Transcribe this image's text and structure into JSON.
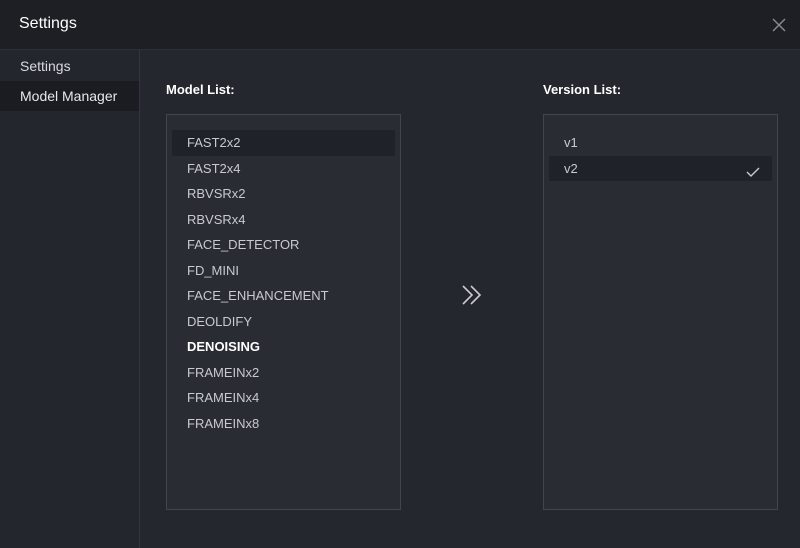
{
  "window": {
    "title": "Settings",
    "close_icon": "close-icon"
  },
  "sidebar": {
    "items": [
      {
        "label": "Settings",
        "active": false
      },
      {
        "label": "Model Manager",
        "active": true
      }
    ]
  },
  "model_list": {
    "label": "Model List:",
    "items": [
      {
        "label": "FAST2x2",
        "highlighted": true
      },
      {
        "label": "FAST2x4"
      },
      {
        "label": "RBVSRx2"
      },
      {
        "label": "RBVSRx4"
      },
      {
        "label": "FACE_DETECTOR"
      },
      {
        "label": "FD_MINI"
      },
      {
        "label": "FACE_ENHANCEMENT"
      },
      {
        "label": "DEOLDIFY"
      },
      {
        "label": "DENOISING",
        "bold": true
      },
      {
        "label": "FRAMEINx2"
      },
      {
        "label": "FRAMEINx4"
      },
      {
        "label": "FRAMEINx8"
      }
    ]
  },
  "transfer_icon": "double-chevron-right-icon",
  "version_list": {
    "label": "Version List:",
    "items": [
      {
        "label": "v1"
      },
      {
        "label": "v2",
        "selected": true,
        "icon": "check-icon"
      }
    ]
  },
  "colors": {
    "background": "#25272e",
    "titlebar": "#1d1f25",
    "panel": "#2a2c33",
    "panel_border": "#43454d",
    "highlight": "#20222a",
    "text": "#c8cad0",
    "text_strong": "#ffffff"
  }
}
